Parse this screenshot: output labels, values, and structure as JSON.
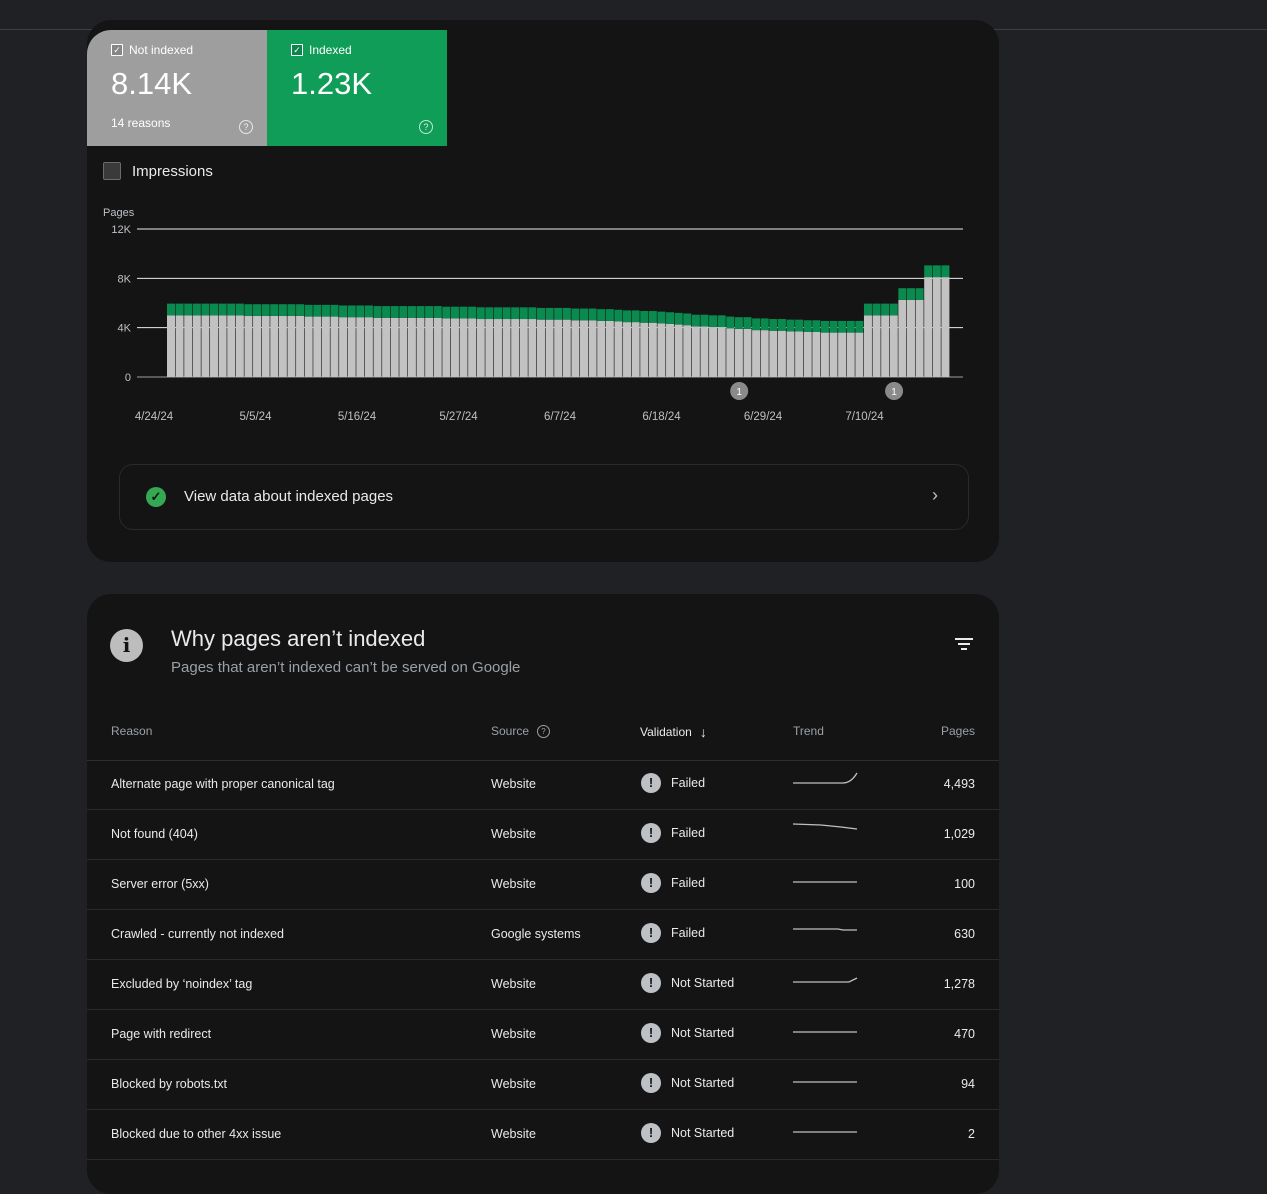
{
  "tiles": {
    "not_indexed": {
      "label": "Not indexed",
      "value": "8.14K",
      "sub": "14 reasons"
    },
    "indexed": {
      "label": "Indexed",
      "value": "1.23K"
    }
  },
  "impressions_label": "Impressions",
  "chart_data": {
    "type": "bar",
    "stacked": true,
    "ylabel": "Pages",
    "ylim": [
      0,
      12000
    ],
    "yticks": [
      "0",
      "4K",
      "8K",
      "12K"
    ],
    "xticks": [
      "4/24/24",
      "5/5/24",
      "5/16/24",
      "5/27/24",
      "6/7/24",
      "6/18/24",
      "6/29/24",
      "7/10/24"
    ],
    "series": [
      {
        "color": "#c2c2c2",
        "values": [
          5000,
          5000,
          5000,
          5000,
          5000,
          5000,
          5000,
          5000,
          5000,
          4950,
          4950,
          4950,
          4950,
          4950,
          4950,
          4950,
          4900,
          4900,
          4900,
          4900,
          4850,
          4850,
          4850,
          4850,
          4800,
          4800,
          4800,
          4800,
          4800,
          4800,
          4800,
          4800,
          4750,
          4750,
          4750,
          4750,
          4700,
          4700,
          4700,
          4700,
          4700,
          4700,
          4700,
          4650,
          4650,
          4650,
          4650,
          4600,
          4600,
          4600,
          4550,
          4550,
          4500,
          4450,
          4450,
          4400,
          4400,
          4350,
          4300,
          4250,
          4200,
          4100,
          4100,
          4050,
          4050,
          3950,
          3900,
          3900,
          3800,
          3800,
          3750,
          3750,
          3700,
          3700,
          3650,
          3650,
          3600,
          3600,
          3600,
          3600,
          3600,
          5000,
          5000,
          5000,
          5000,
          6250,
          6250,
          6250,
          8100,
          8100,
          8100
        ]
      },
      {
        "color": "#0b8a4f",
        "values": [
          950,
          950,
          950,
          950,
          950,
          950,
          950,
          950,
          950,
          950,
          950,
          950,
          950,
          950,
          950,
          950,
          950,
          950,
          950,
          950,
          950,
          950,
          950,
          950,
          950,
          950,
          950,
          950,
          950,
          950,
          950,
          950,
          950,
          950,
          950,
          950,
          950,
          950,
          950,
          950,
          950,
          950,
          950,
          950,
          950,
          950,
          950,
          950,
          950,
          950,
          950,
          950,
          950,
          950,
          950,
          950,
          950,
          950,
          950,
          950,
          950,
          950,
          950,
          950,
          950,
          950,
          950,
          950,
          950,
          950,
          950,
          950,
          950,
          950,
          950,
          950,
          950,
          950,
          950,
          950,
          950,
          950,
          950,
          950,
          950,
          950,
          950,
          950,
          950,
          950,
          950
        ]
      }
    ],
    "annotations": [
      {
        "x_index": 66,
        "label": "1"
      },
      {
        "x_index": 84,
        "label": "1"
      }
    ],
    "grid": true
  },
  "view_indexed_label": "View data about indexed pages",
  "why": {
    "title": "Why pages aren’t indexed",
    "subtitle": "Pages that aren’t indexed can’t be served on Google"
  },
  "table": {
    "headers": {
      "reason": "Reason",
      "source": "Source",
      "validation": "Validation",
      "trend": "Trend",
      "pages": "Pages"
    },
    "rows": [
      {
        "reason": "Alternate page with proper canonical tag",
        "source": "Website",
        "validation": "Failed",
        "trend": "up-end",
        "pages": "4,493"
      },
      {
        "reason": "Not found (404)",
        "source": "Website",
        "validation": "Failed",
        "trend": "slight-down",
        "pages": "1,029"
      },
      {
        "reason": "Server error (5xx)",
        "source": "Website",
        "validation": "Failed",
        "trend": "flat",
        "pages": "100"
      },
      {
        "reason": "Crawled - currently not indexed",
        "source": "Google systems",
        "validation": "Failed",
        "trend": "flat-dip",
        "pages": "630"
      },
      {
        "reason": "Excluded by ‘noindex’ tag",
        "source": "Website",
        "validation": "Not Started",
        "trend": "small-up-end",
        "pages": "1,278"
      },
      {
        "reason": "Page with redirect",
        "source": "Website",
        "validation": "Not Started",
        "trend": "flat",
        "pages": "470"
      },
      {
        "reason": "Blocked by robots.txt",
        "source": "Website",
        "validation": "Not Started",
        "trend": "flat",
        "pages": "94"
      },
      {
        "reason": "Blocked due to other 4xx issue",
        "source": "Website",
        "validation": "Not Started",
        "trend": "flat",
        "pages": "2"
      }
    ]
  }
}
